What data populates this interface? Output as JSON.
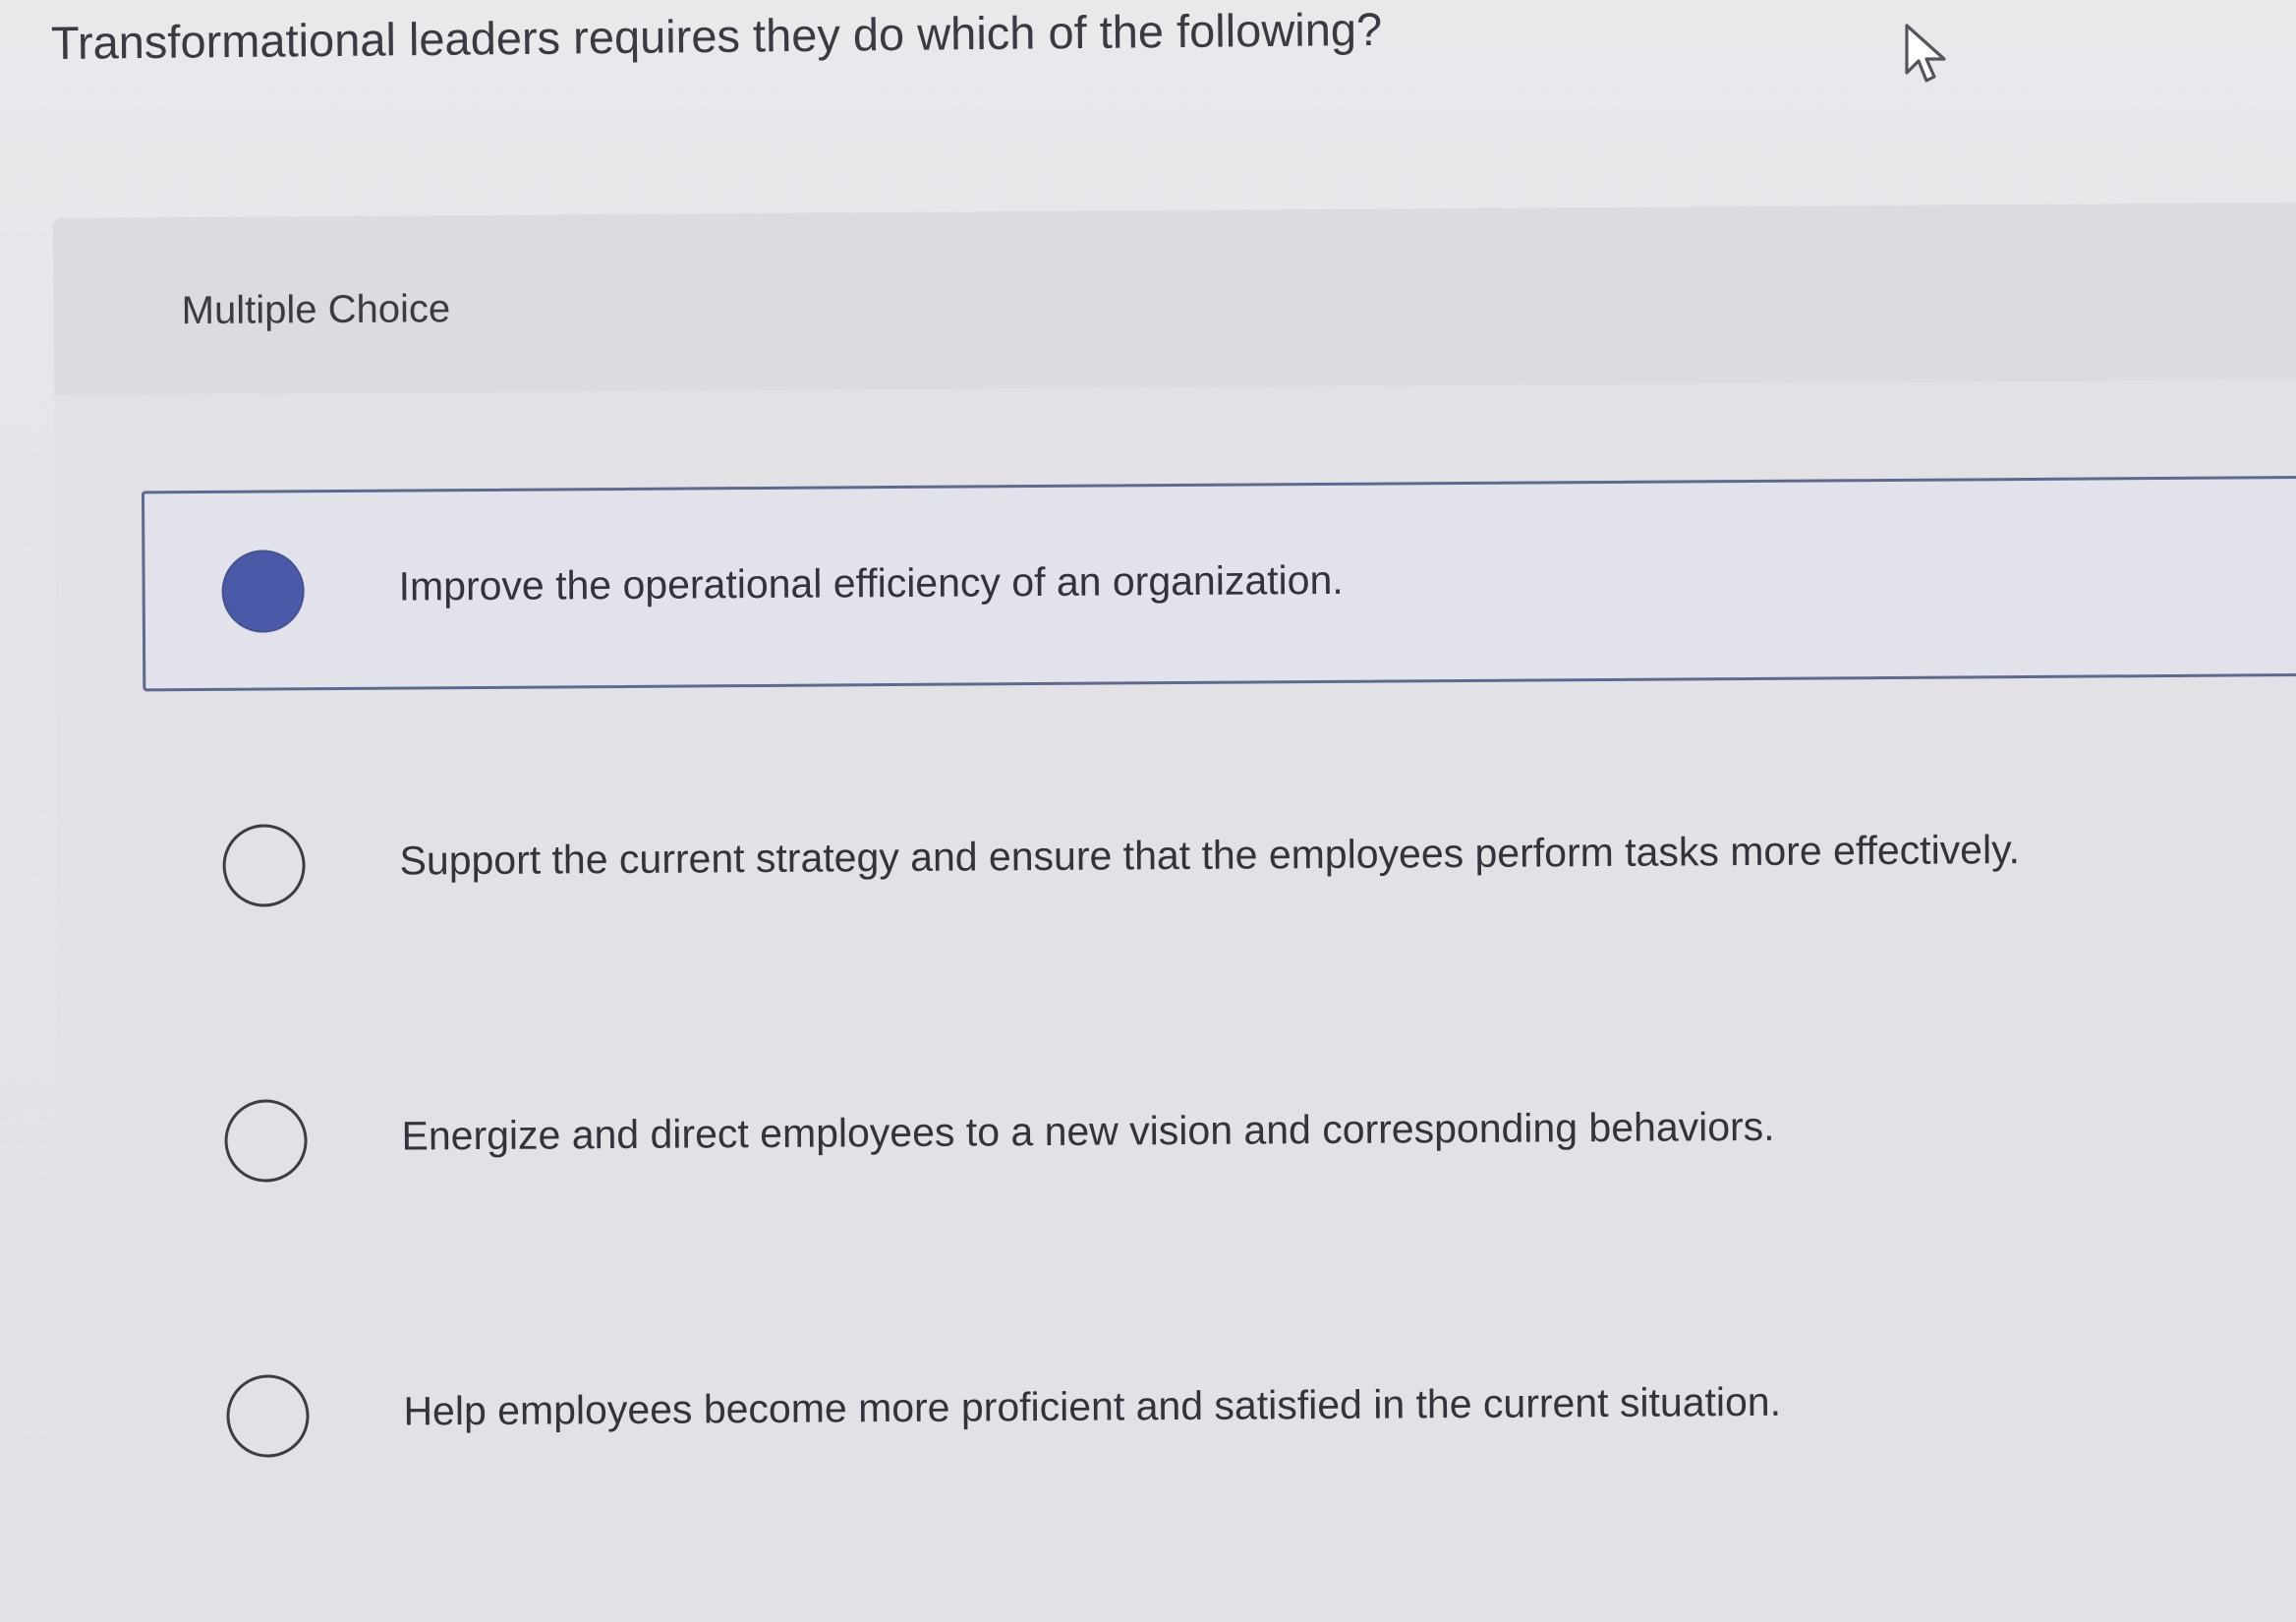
{
  "question": {
    "text": "Transformational leaders requires they do which of the following?"
  },
  "panel": {
    "title": "Multiple Choice"
  },
  "options": [
    {
      "label": "Improve the operational efficiency of an organization.",
      "selected": true
    },
    {
      "label": "Support the current strategy and ensure that the employees perform tasks more effectively.",
      "selected": false
    },
    {
      "label": "Energize and direct employees to a new vision and corresponding behaviors.",
      "selected": false
    },
    {
      "label": "Help employees become more proficient and satisfied in the current situation.",
      "selected": false
    }
  ],
  "colors": {
    "selected_radio": "#4a5aa8",
    "selected_border": "#5d6a8f",
    "background": "#e6e4e9"
  },
  "icons": {
    "cursor": "mouse-pointer-icon",
    "radio_selected": "radio-filled-icon",
    "radio_unselected": "radio-empty-icon"
  }
}
